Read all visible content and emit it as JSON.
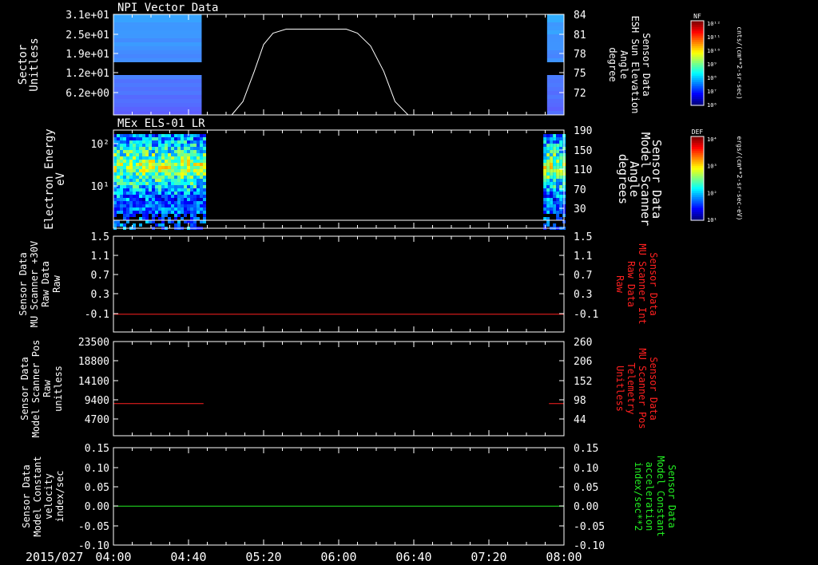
{
  "footer": {
    "date": "2015/027"
  },
  "x_ticks": [
    "04:00",
    "04:40",
    "05:20",
    "06:00",
    "06:40",
    "07:20",
    "08:00"
  ],
  "colors": {
    "background": "#000000",
    "axis": "#ffffff",
    "red": "#ff2020",
    "green": "#22ee22"
  },
  "colorbars": [
    {
      "title": "NF",
      "unit": "cnts/(cm**2-sr-sec)",
      "ticks": [
        "10¹²",
        "10¹¹",
        "10¹⁰",
        "10⁹",
        "10⁸",
        "10⁷",
        "10⁶"
      ]
    },
    {
      "title": "DEF",
      "unit": "ergs/(cm**2-sr-sec-eV)",
      "ticks": [
        "10⁴",
        "10³",
        "10²",
        "10¹"
      ]
    }
  ],
  "chart_data": [
    {
      "type": "heatmap",
      "title": "NPI Vector Data",
      "ylabel_lines": [
        "Sector",
        "Unitless"
      ],
      "y_ticks": [
        "3.1e+01",
        "2.5e+01",
        "1.9e+01",
        "1.2e+01",
        "6.2e+00"
      ],
      "y2label_lines": [
        "Sensor Data",
        "ESH Sun Elevation",
        "Angle",
        "degree"
      ],
      "y2_ticks": [
        "84",
        "81",
        "78",
        "75",
        "72"
      ],
      "y2lim": [
        69,
        84
      ],
      "data_blocks": [
        {
          "x": [
            "04:00",
            "04:47"
          ]
        },
        {
          "x": [
            "07:51",
            "08:00"
          ]
        }
      ],
      "series": [
        {
          "x": [
            "05:03",
            "05:09",
            "05:15",
            "05:20",
            "05:25",
            "05:32",
            "06:04",
            "06:10",
            "06:17",
            "06:24",
            "06:30",
            "06:37"
          ],
          "values": [
            69,
            71,
            75.5,
            79.5,
            81.2,
            81.8,
            81.8,
            81.2,
            79.3,
            75.5,
            71,
            69
          ]
        }
      ]
    },
    {
      "type": "heatmap",
      "title": "MEx ELS-01 LR",
      "ylabel_lines": [
        "Electron Energy",
        "eV"
      ],
      "y_ticks": [
        "10²",
        "10¹"
      ],
      "y2label_lines": [
        "Sensor Data",
        "Model Scanner",
        "Angle",
        "degrees"
      ],
      "y2_ticks": [
        "190",
        "150",
        "110",
        "70",
        "30"
      ],
      "y2lim": [
        0,
        190
      ],
      "data_blocks": [
        {
          "x": [
            "04:00",
            "04:48"
          ]
        },
        {
          "x": [
            "07:49",
            "08:00"
          ]
        }
      ],
      "series": [
        {
          "x": [
            "04:00",
            "08:00"
          ],
          "values": [
            10,
            10
          ]
        }
      ]
    },
    {
      "type": "line",
      "ylabel_lines": [
        "Sensor Data",
        "MU Scanner +30V",
        "Raw Data",
        "Raw"
      ],
      "y_ticks": [
        "1.5",
        "1.1",
        "0.7",
        "0.3",
        "-0.1"
      ],
      "y2label_lines": [
        "Sensor Data",
        "MU Scanner Int",
        "Raw Data",
        "Raw"
      ],
      "y2_ticks": [
        "1.5",
        "1.1",
        "0.7",
        "0.3",
        "-0.1"
      ],
      "ylim": [
        -0.34,
        1.5
      ],
      "series": [
        {
          "color": "#ff2020",
          "x": [
            "04:00",
            "08:00"
          ],
          "values": [
            0,
            0
          ]
        }
      ]
    },
    {
      "type": "line",
      "ylabel_lines": [
        "Sensor Data",
        "Model Scanner Pos",
        "Raw",
        "unitless"
      ],
      "y_ticks": [
        "23500",
        "18800",
        "14100",
        "9400",
        "4700"
      ],
      "y2label_lines": [
        "Sensor Data",
        "MU Scanner Pos",
        "Telemetry",
        "Unitless"
      ],
      "y2_ticks": [
        "260",
        "206",
        "152",
        "98",
        "44"
      ],
      "ylim": [
        0,
        23500
      ],
      "series": [
        {
          "color": "#ff2020",
          "x": [
            "04:00",
            "04:48"
          ],
          "values": [
            8000,
            8000
          ]
        },
        {
          "color": "#ff2020",
          "x": [
            "07:52",
            "08:00"
          ],
          "values": [
            8000,
            8000
          ]
        }
      ]
    },
    {
      "type": "line",
      "ylabel_lines": [
        "Sensor Data",
        "Model Constant",
        "velocity",
        "index/sec"
      ],
      "y_ticks": [
        "0.15",
        "0.10",
        "0.05",
        "0.00",
        "-0.05",
        "-0.10"
      ],
      "y2label_lines": [
        "Sensor Data",
        "Model Constant",
        "acceleration",
        "index/sec**2"
      ],
      "y2_ticks": [
        "0.15",
        "0.10",
        "0.05",
        "0.00",
        "-0.05",
        "-0.10"
      ],
      "ylim": [
        -0.1,
        0.15
      ],
      "series": [
        {
          "color": "#22ee22",
          "x": [
            "04:00",
            "08:00"
          ],
          "values": [
            0,
            0
          ]
        }
      ]
    }
  ]
}
